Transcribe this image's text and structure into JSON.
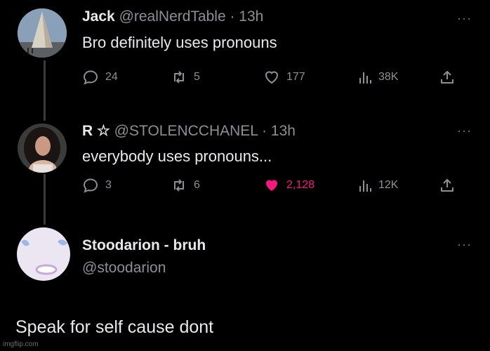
{
  "tweets": [
    {
      "name": "Jack",
      "handle": "@realNerdTable",
      "time": "· 13h",
      "text": "Bro definitely uses pronouns",
      "replies": "24",
      "reposts": "5",
      "likes": "177",
      "views": "38K"
    },
    {
      "name": "R ☆",
      "handle": "@STOLENCCHANEL",
      "time": "· 13h",
      "text": "everybody uses pronouns...",
      "replies": "3",
      "reposts": "6",
      "likes": "2,128",
      "views": "12K"
    }
  ],
  "reply": {
    "name": "Stoodarion - bruh",
    "handle": "@stoodarion",
    "text": "Speak for  self cause  dont"
  },
  "more_glyph": "···",
  "watermark": "imgflip.com",
  "colors": {
    "background": "#000000",
    "text": "#e7e9ea",
    "muted": "#8b9096",
    "like_active": "#f91880"
  },
  "icons": [
    "reply-icon",
    "repost-icon",
    "like-icon",
    "views-icon",
    "share-icon",
    "more-icon"
  ]
}
